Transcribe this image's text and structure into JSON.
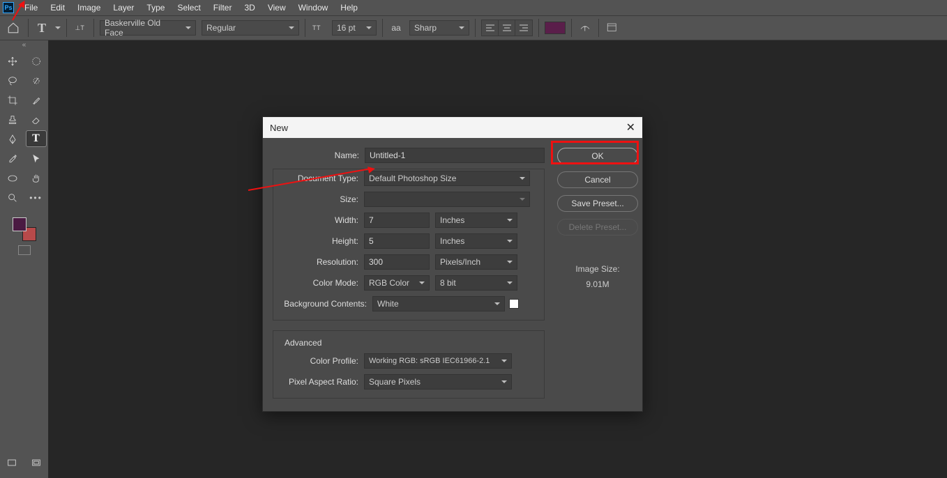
{
  "menu": {
    "items": [
      "File",
      "Edit",
      "Image",
      "Layer",
      "Type",
      "Select",
      "Filter",
      "3D",
      "View",
      "Window",
      "Help"
    ]
  },
  "options": {
    "font_family": "Baskerville Old Face",
    "font_style": "Regular",
    "font_size": "16 pt",
    "aa_label": "aa",
    "aa_mode": "Sharp"
  },
  "dialog": {
    "title": "New",
    "name_label": "Name:",
    "name_value": "Untitled-1",
    "doctype_label": "Document Type:",
    "doctype_value": "Default Photoshop Size",
    "size_label": "Size:",
    "size_value": "",
    "width_label": "Width:",
    "width_value": "7",
    "width_unit": "Inches",
    "height_label": "Height:",
    "height_value": "5",
    "height_unit": "Inches",
    "res_label": "Resolution:",
    "res_value": "300",
    "res_unit": "Pixels/Inch",
    "cmode_label": "Color Mode:",
    "cmode_value": "RGB Color",
    "cdepth_value": "8 bit",
    "bg_label": "Background Contents:",
    "bg_value": "White",
    "advanced_label": "Advanced",
    "cprofile_label": "Color Profile:",
    "cprofile_value": "Working RGB:  sRGB IEC61966-2.1",
    "par_label": "Pixel Aspect Ratio:",
    "par_value": "Square Pixels",
    "ok": "OK",
    "cancel": "Cancel",
    "save_preset": "Save Preset...",
    "delete_preset": "Delete Preset...",
    "img_size_label": "Image Size:",
    "img_size_value": "9.01M"
  }
}
